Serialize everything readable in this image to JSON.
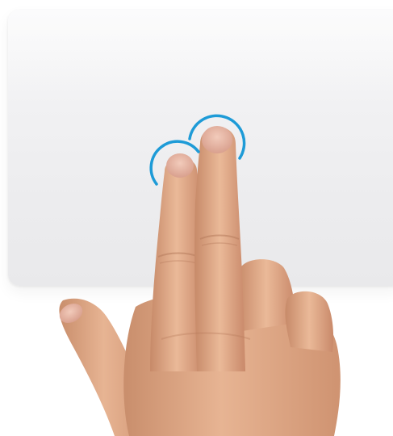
{
  "illustration": {
    "surface": "trackpad",
    "gesture": "two-finger-tap",
    "fingers_touching": 2
  },
  "colors": {
    "background": "#ffffff",
    "trackpad": "#efeff1",
    "touch_ring": "#1e9bd7",
    "skin": "#e0a886",
    "skin_shadow": "#c98e6c",
    "nail": "#e9b9a8"
  },
  "icons": [
    "touch-ring-icon",
    "touch-ring-icon"
  ]
}
